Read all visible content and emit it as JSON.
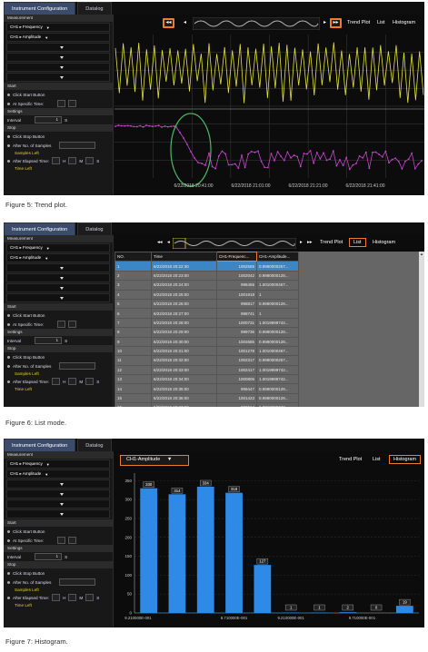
{
  "panel": {
    "measurement": "Measurement",
    "ch1_freq": "CH1 ▸ Frequency",
    "ch1_amp": "CH1 ▸ Amplitude",
    "start": "Start",
    "click_start": "Click Start Button",
    "at_specific": "At Specific Time:",
    "settings": "Settings",
    "interval": "Interval",
    "interval_val": "1",
    "interval_unit": "S",
    "stop": "Stop",
    "click_stop": "Click Stop Button",
    "after_samples": "After No. of Samples",
    "samples_left": "Samples Left",
    "after_elapsed": "After Elapsed Time:",
    "h": "H",
    "m": "M",
    "s": "S",
    "time_left": "Time Left"
  },
  "tabs": [
    "Instrument Configuration",
    "Datalog"
  ],
  "views": {
    "trend": "Trend Plot",
    "list": "List",
    "histogram": "Histogram"
  },
  "trend": {
    "x_ticks": [
      "6/22/2018 20:41:00",
      "6/22/2018 21:01:00",
      "6/22/2018 21:21:00",
      "6/22/2018 21:41:00"
    ],
    "colors": {
      "freq": "#e8e23a",
      "amp": "#c844cf",
      "ellipse": "#4ab867",
      "grid": "#3b3b3b"
    }
  },
  "list": {
    "headers": [
      "NO.",
      "Time",
      "CH1-Frequenc...",
      "CH1-Amplitude..."
    ],
    "rows": [
      [
        "1",
        "6/22/2018 20:22:30",
        "1002565",
        "0.9980000257..."
      ],
      [
        "2",
        "6/22/2018 20:23:00",
        "1002042",
        "0.9980000128..."
      ],
      [
        "3",
        "6/22/2018 20:24:00",
        "998455",
        "1.0010000467..."
      ],
      [
        "4",
        "6/22/2018 20:25:00",
        "1001918",
        "1"
      ],
      [
        "5",
        "6/22/2018 20:26:00",
        "998817",
        "0.9980000128..."
      ],
      [
        "6",
        "6/22/2018 20:27:00",
        "998741",
        "1"
      ],
      [
        "7",
        "6/22/2018 20:28:00",
        "1000731",
        "1.0019999742..."
      ],
      [
        "8",
        "6/22/2018 20:29:00",
        "999736",
        "0.9980000128..."
      ],
      [
        "9",
        "6/22/2018 20:30:00",
        "1002685",
        "0.9980000128..."
      ],
      [
        "10",
        "6/22/2018 20:31:00",
        "1001278",
        "1.0010000467..."
      ],
      [
        "11",
        "6/22/2018 20:32:00",
        "1002317",
        "0.9980000257..."
      ],
      [
        "12",
        "6/22/2018 20:33:00",
        "1002417",
        "1.0019999742..."
      ],
      [
        "13",
        "6/22/2018 20:34:00",
        "1000805",
        "1.0019999742..."
      ],
      [
        "14",
        "6/22/2018 20:35:00",
        "999447",
        "0.9990000128..."
      ],
      [
        "15",
        "6/22/2018 20:36:00",
        "1001423",
        "0.9980000128..."
      ],
      [
        "16",
        "6/22/2018 20:37:00",
        "998614",
        "1.0019999742..."
      ]
    ]
  },
  "histogram": {
    "selector": "CH1-Amplitude",
    "chart_data": {
      "type": "bar",
      "values": [
        330,
        314,
        334,
        318,
        127,
        1,
        1,
        2,
        0,
        19
      ],
      "value_labels": [
        "330",
        "314",
        "334",
        "318",
        "127",
        "1",
        "1",
        "2",
        "0",
        "19"
      ],
      "x_ticks": [
        "9.210000E-001",
        "8.710000E-001",
        "9.210000E-001",
        "9.710000E-001"
      ],
      "y_ticks": [
        "0",
        "50",
        "100",
        "150",
        "200",
        "250",
        "300",
        "350"
      ],
      "ylim": [
        0,
        370
      ],
      "bar_color": "#2e8ae6"
    }
  },
  "captions": {
    "fig5": "Figure 5: Trend plot.",
    "fig6": "Figure 6: List mode.",
    "fig7": "Figure 7: Histogram."
  }
}
